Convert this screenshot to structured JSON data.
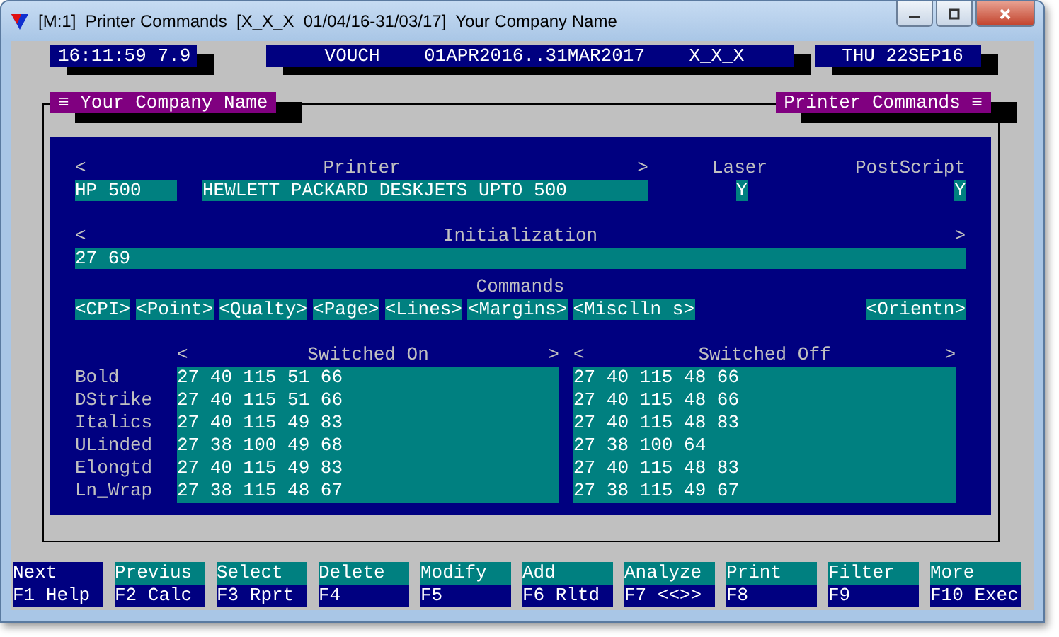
{
  "window": {
    "title": "[M:1]  Printer Commands  [X_X_X  01/04/16-31/03/17]  Your Company Name"
  },
  "status": {
    "clock": "16:11:59 7.9",
    "context": "VOUCH    01APR2016..31MAR2017    X_X_X",
    "date": "THU 22SEP16"
  },
  "frame": {
    "left_title": "≡ Your Company Name",
    "right_title": "Printer Commands ≡"
  },
  "printer": {
    "header_left": "<",
    "header": "Printer",
    "header_right": ">",
    "laser_label": "Laser",
    "postscript_label": "PostScript",
    "code": "HP 500",
    "name": "HEWLETT PACKARD DESKJETS UPTO 500",
    "laser": "Y",
    "postscript": "Y"
  },
  "initialization": {
    "header_left": "<",
    "header": "Initialization",
    "header_right": ">",
    "value": "27 69"
  },
  "commands": {
    "label": "Commands",
    "buttons": [
      "<CPI>",
      "<Point>",
      "<Qualty>",
      "<Page>",
      "<Lines>",
      "<Margins>",
      "<Misclln s>",
      "<Orientn>"
    ]
  },
  "switches": {
    "on_header": {
      "left": "<",
      "label": "Switched On",
      "right": ">"
    },
    "off_header": {
      "left": "<",
      "label": "Switched Off",
      "right": ">"
    },
    "rows": [
      {
        "name": "Bold",
        "on": "27 40 115 51 66",
        "off": "27 40 115 48 66"
      },
      {
        "name": "DStrike",
        "on": "27 40 115 51 66",
        "off": "27 40 115 48 66"
      },
      {
        "name": "Italics",
        "on": "27 40 115 49 83",
        "off": "27 40 115 48 83"
      },
      {
        "name": "ULinded",
        "on": "27 38 100 49 68",
        "off": "27 38 100 64"
      },
      {
        "name": "Elongtd",
        "on": "27 40 115 49 83",
        "off": "27 40 115 48 83"
      },
      {
        "name": "Ln_Wrap",
        "on": "27 38 115 48 67",
        "off": "27 38 115 49 67"
      }
    ]
  },
  "function_keys": [
    {
      "action": "Next",
      "key": "F1 Help",
      "selected": true
    },
    {
      "action": "Previus",
      "key": "F2 Calc",
      "selected": false
    },
    {
      "action": "Select",
      "key": "F3 Rprt",
      "selected": false
    },
    {
      "action": "Delete",
      "key": "F4",
      "selected": false
    },
    {
      "action": "Modify",
      "key": "F5",
      "selected": false
    },
    {
      "action": "Add",
      "key": "F6 Rltd",
      "selected": false
    },
    {
      "action": "Analyze",
      "key": "F7 <<>>",
      "selected": false
    },
    {
      "action": "Print",
      "key": "F8",
      "selected": false
    },
    {
      "action": "Filter",
      "key": "F9",
      "selected": false
    },
    {
      "action": "More",
      "key": "F10 Exec",
      "selected": false
    }
  ]
}
